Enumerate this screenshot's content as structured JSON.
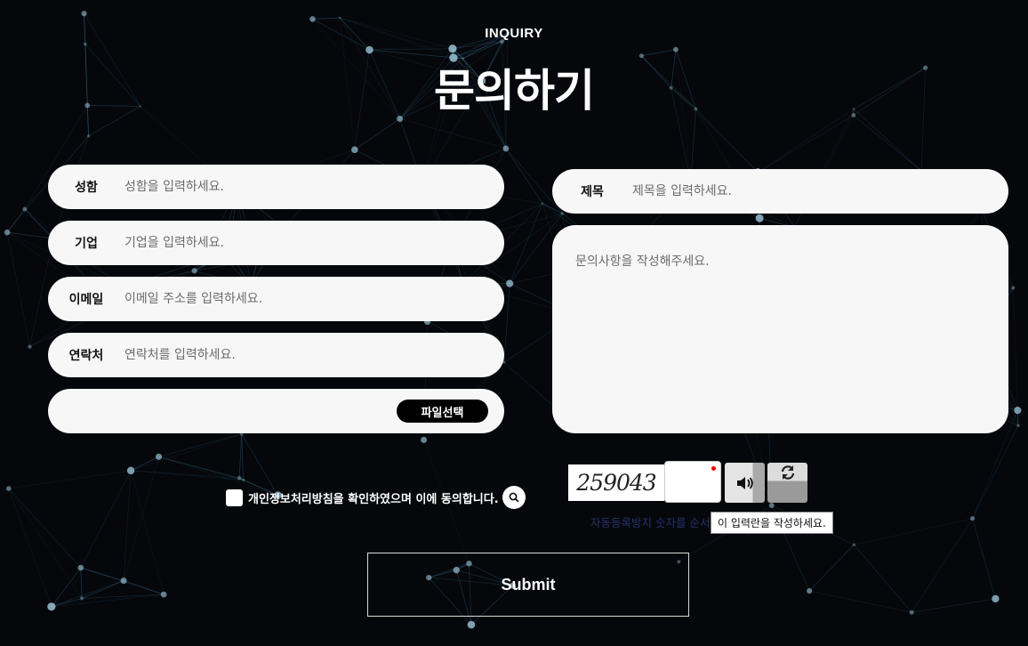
{
  "header": {
    "eyebrow": "INQUIRY",
    "title": "문의하기"
  },
  "form": {
    "name": {
      "label": "성함",
      "placeholder": "성함을 입력하세요."
    },
    "company": {
      "label": "기업",
      "placeholder": "기업을 입력하세요."
    },
    "email": {
      "label": "이메일",
      "placeholder": "이메일 주소를 입력하세요."
    },
    "phone": {
      "label": "연락처",
      "placeholder": "연락처를 입력하세요."
    },
    "file": {
      "button_label": "파일선택"
    },
    "subject": {
      "label": "제목",
      "placeholder": "제목을 입력하세요."
    },
    "message": {
      "placeholder": "문의사항을 작성해주세요."
    }
  },
  "agreement": {
    "text": "개인정보처리방침을 확인하였으며 이에 동의합니다."
  },
  "captcha": {
    "image_text": "259043",
    "help_text": "자동등록방지 숫자를 순서",
    "tooltip": "이 입력란을 작성하세요."
  },
  "submit_label": "Submit",
  "colors": {
    "background": "#05070b",
    "field": "#f7f7f7",
    "accent": "#000000"
  }
}
